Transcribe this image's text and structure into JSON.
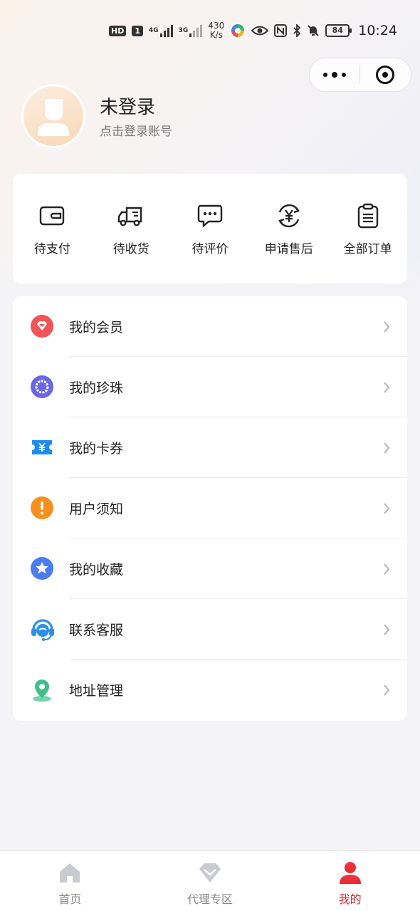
{
  "status_bar": {
    "hd": "HD",
    "sim": "1",
    "net1": "4G",
    "net2": "3G",
    "speed_value": "430",
    "speed_unit": "K/s",
    "battery": "84",
    "time": "10:24"
  },
  "capsule": {
    "more_icon": "more-dots-icon",
    "close_icon": "target-close-icon"
  },
  "profile": {
    "name": "未登录",
    "subtitle": "点击登录账号"
  },
  "orders": {
    "items": [
      {
        "label": "待支付",
        "icon": "wallet-icon"
      },
      {
        "label": "待收货",
        "icon": "truck-icon"
      },
      {
        "label": "待评价",
        "icon": "chat-bubble-icon"
      },
      {
        "label": "申请售后",
        "icon": "yuan-refund-icon"
      },
      {
        "label": "全部订单",
        "icon": "clipboard-icon"
      }
    ]
  },
  "menu": {
    "items": [
      {
        "label": "我的会员",
        "icon": "diamond-heart-icon",
        "color": "#f05454"
      },
      {
        "label": "我的珍珠",
        "icon": "pearl-icon",
        "color": "#6a67e6"
      },
      {
        "label": "我的卡券",
        "icon": "coupon-icon",
        "color": "#1e8cf0"
      },
      {
        "label": "用户须知",
        "icon": "exclamation-icon",
        "color": "#f5901f"
      },
      {
        "label": "我的收藏",
        "icon": "star-icon",
        "color": "#4a7df0"
      },
      {
        "label": "联系客服",
        "icon": "headset-icon",
        "color": "#2f8fe8"
      },
      {
        "label": "地址管理",
        "icon": "location-pin-icon",
        "color": "#3dbf8a"
      }
    ]
  },
  "tabs": {
    "items": [
      {
        "label": "首页",
        "icon": "home-icon"
      },
      {
        "label": "代理专区",
        "icon": "diamond-icon"
      },
      {
        "label": "我的",
        "icon": "user-icon",
        "active": true
      }
    ],
    "active_color": "#e0262b"
  }
}
